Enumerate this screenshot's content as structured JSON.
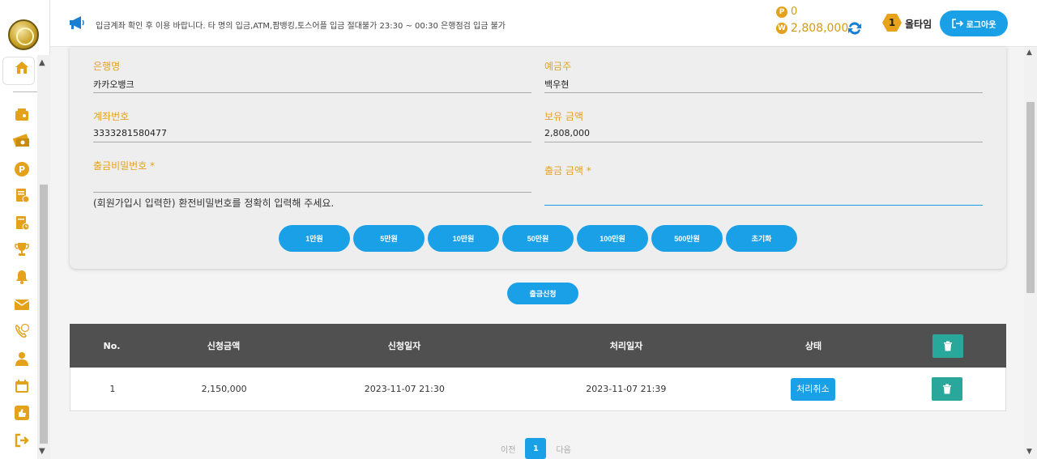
{
  "topbar": {
    "notice": "입금계좌 확인 후 이용 바랍니다. 타 명의 입금,ATM,팜뱅킹,토스어플 입금 절대불가 23:30 ~ 00:30 은행점검 입금 불가",
    "points": "0",
    "point_badge": "P",
    "money": "2,808,000",
    "money_badge": "W",
    "level": "1",
    "username": "올타임",
    "logout_label": "로그아웃"
  },
  "sidebar": {
    "icons": [
      "home-icon",
      "wallet-icon",
      "cash-icon",
      "point-icon",
      "deposit-list-icon",
      "withdraw-list-icon",
      "trophy-icon",
      "bell-icon",
      "mail-icon",
      "support-icon",
      "user-icon",
      "calendar-icon",
      "thumbs-up-icon",
      "logout-icon"
    ]
  },
  "form": {
    "bank_label": "은행명",
    "bank_value": "카카오뱅크",
    "holder_label": "예금주",
    "holder_value": "백우현",
    "account_label": "계좌번호",
    "account_value": "3333281580477",
    "balance_label": "보유 금액",
    "balance_value": "2,808,000",
    "password_label": "출금비밀번호 *",
    "password_hint": "(회원가입시 입력한) 환전비밀번호를 정확히 입력해 주세요.",
    "amount_label": "출금 금액 *",
    "amount_value": "",
    "chips": [
      "1만원",
      "5만원",
      "10만원",
      "50만원",
      "100만원",
      "500만원",
      "초기화"
    ]
  },
  "submit_label": "출금신청",
  "table": {
    "headers": [
      "No.",
      "신청금액",
      "신청일자",
      "처리일자",
      "상태"
    ],
    "rows": [
      {
        "no": "1",
        "amount": "2,150,000",
        "requested": "2023-11-07 21:30",
        "processed": "2023-11-07 21:39",
        "status": "처리취소"
      }
    ]
  },
  "pager": {
    "prev": "이전",
    "current": "1",
    "next": "다음"
  },
  "colors": {
    "accent": "#1aa0e6",
    "gold": "#e3a21a",
    "header": "#505050",
    "delete": "#29a79a"
  }
}
